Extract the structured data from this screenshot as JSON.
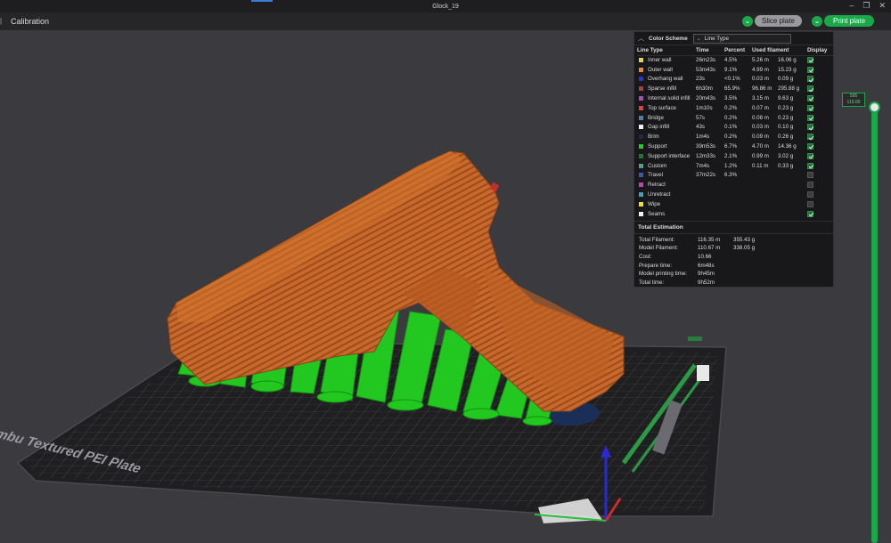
{
  "window": {
    "title": "Glock_19"
  },
  "toolbar": {
    "calibration": "Calibration",
    "slice_label": "Slice plate",
    "print_label": "Print plate"
  },
  "legend": {
    "color_scheme_label": "Color Scheme",
    "color_scheme_value": "Line Type",
    "columns": [
      "Line Type",
      "Time",
      "Percent",
      "Used filament",
      "Display"
    ],
    "rows": [
      {
        "name": "Inner wall",
        "color": "#f0d044",
        "time": "26m23s",
        "percent": "4.5%",
        "len": "5.26 m",
        "weight": "16.06 g",
        "display": true
      },
      {
        "name": "Outer wall",
        "color": "#f08a28",
        "time": "53m43s",
        "percent": "9.1%",
        "len": "4.99 m",
        "weight": "15.23 g",
        "display": true
      },
      {
        "name": "Overhang wall",
        "color": "#2a34c8",
        "time": "23s",
        "percent": "<0.1%",
        "len": "0.03 m",
        "weight": "0.09 g",
        "display": true
      },
      {
        "name": "Sparse infill",
        "color": "#a8403a",
        "time": "6h30m",
        "percent": "65.9%",
        "len": "96.86 m",
        "weight": "295.88 g",
        "display": true
      },
      {
        "name": "Internal solid infill",
        "color": "#a050b8",
        "time": "20m43s",
        "percent": "3.5%",
        "len": "3.15 m",
        "weight": "9.63 g",
        "display": true
      },
      {
        "name": "Top surface",
        "color": "#e04040",
        "time": "1m10s",
        "percent": "0.2%",
        "len": "0.07 m",
        "weight": "0.23 g",
        "display": true
      },
      {
        "name": "Bridge",
        "color": "#4a80b0",
        "time": "57s",
        "percent": "0.2%",
        "len": "0.08 m",
        "weight": "0.23 g",
        "display": true
      },
      {
        "name": "Gap infill",
        "color": "#f0f0f0",
        "time": "43s",
        "percent": "0.1%",
        "len": "0.03 m",
        "weight": "0.10 g",
        "display": true
      },
      {
        "name": "Brim",
        "color": "#1a2a50",
        "time": "1m4s",
        "percent": "0.2%",
        "len": "0.09 m",
        "weight": "0.26 g",
        "display": true
      },
      {
        "name": "Support",
        "color": "#22cc22",
        "time": "39m53s",
        "percent": "6.7%",
        "len": "4.70 m",
        "weight": "14.36 g",
        "display": true
      },
      {
        "name": "Support interface",
        "color": "#1a7a2a",
        "time": "12m33s",
        "percent": "2.1%",
        "len": "0.99 m",
        "weight": "3.02 g",
        "display": true
      },
      {
        "name": "Custom",
        "color": "#40a890",
        "time": "7m4s",
        "percent": "1.2%",
        "len": "0.11 m",
        "weight": "0.33 g",
        "display": true
      },
      {
        "name": "Travel",
        "color": "#3a5aa8",
        "time": "37m22s",
        "percent": "6.3%",
        "len": "",
        "weight": "",
        "display": false
      },
      {
        "name": "Retract",
        "color": "#c040c0",
        "time": "",
        "percent": "",
        "len": "",
        "weight": "",
        "display": false
      },
      {
        "name": "Unretract",
        "color": "#40a0c0",
        "time": "",
        "percent": "",
        "len": "",
        "weight": "",
        "display": false
      },
      {
        "name": "Wipe",
        "color": "#f0e020",
        "time": "",
        "percent": "",
        "len": "",
        "weight": "",
        "display": false
      },
      {
        "name": "Seams",
        "color": "#f0f0f0",
        "time": "",
        "percent": "",
        "len": "",
        "weight": "",
        "display": true
      }
    ],
    "estimation_title": "Total Estimation",
    "estimation": [
      {
        "key": "Total Filament:",
        "v1": "116.35 m",
        "v2": "355.43 g"
      },
      {
        "key": "Model Filament:",
        "v1": "110.67 m",
        "v2": "338.05 g"
      },
      {
        "key": "Cost:",
        "v1": "10.66",
        "v2": ""
      },
      {
        "key": "Prepare time:",
        "v1": "6m48s",
        "v2": ""
      },
      {
        "key": "Model printing time:",
        "v1": "9h45m",
        "v2": ""
      },
      {
        "key": "Total time:",
        "v1": "9h52m",
        "v2": ""
      }
    ]
  },
  "plate": {
    "label": "Bambu Textured PEI Plate"
  },
  "layer_slider": {
    "top_value": "595",
    "top_height": "119.00"
  }
}
